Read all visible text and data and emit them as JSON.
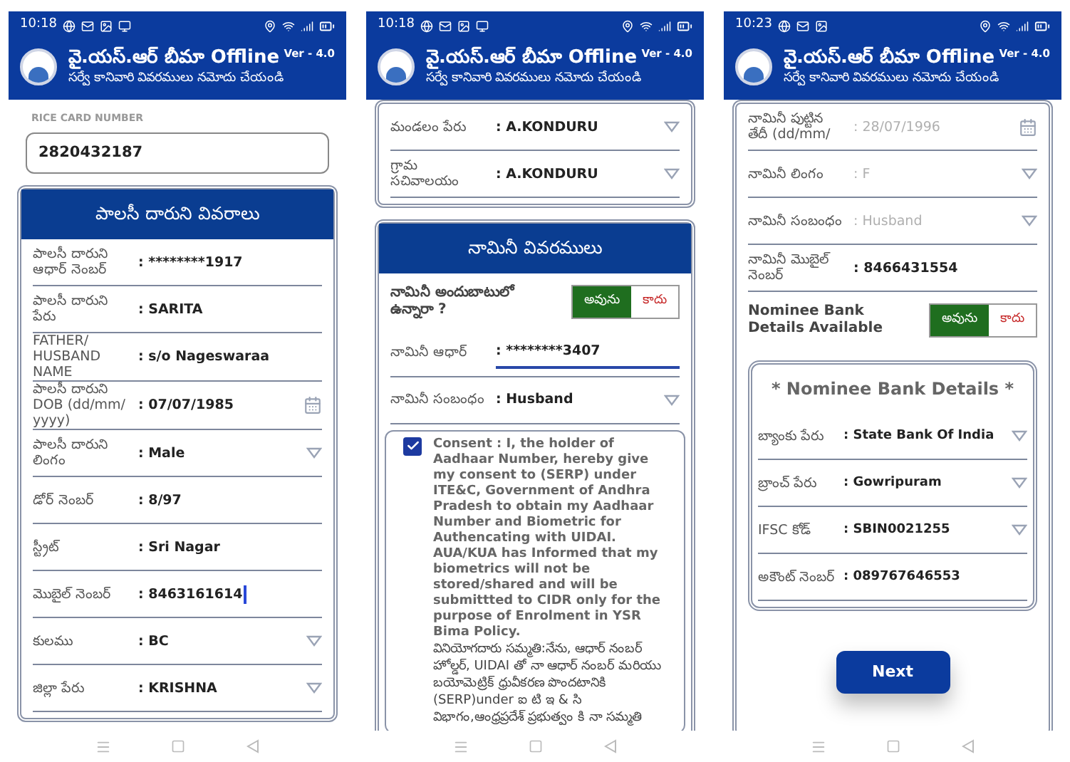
{
  "phones": [
    {
      "status_time": "10:18",
      "notification_icons": [
        {
          "kind": "globe"
        },
        {
          "kind": "mail"
        },
        {
          "kind": "image"
        },
        {
          "kind": "screen"
        }
      ],
      "header": {
        "title": "వై.యస్.ఆర్ బీమా Offline",
        "version": "Ver - 4.0",
        "subtitle": "సర్వే కానివారి వివరములు నమోదు చేయండి"
      },
      "sections": [
        {
          "kind": "rice_card",
          "label": "RICE CARD NUMBER",
          "value": "2820432187"
        },
        {
          "kind": "panel",
          "heading": "పాలసీ దారుని వివరాలు",
          "items": [
            {
              "kind": "text_row",
              "label": "పాలసీ దారుని ఆధార్ నెంబర్",
              "value": ": ********1917",
              "disabled": false,
              "focused": false
            },
            {
              "kind": "text_row",
              "label": "పాలసీ దారుని పేరు",
              "value": ": SARITA",
              "disabled": false,
              "focused": false
            },
            {
              "kind": "text_row",
              "label": "FATHER/ HUSBAND NAME",
              "value": ": s/o Nageswaraa",
              "disabled": false,
              "focused": false
            },
            {
              "kind": "date_row",
              "label": "పాలసీ దారుని DOB (dd/mm/ yyyy)",
              "value": ": 07/07/1985",
              "disabled": false,
              "focused": false
            },
            {
              "kind": "dropdown_row",
              "label": "పాలసీ దారుని లింగం",
              "value": ": Male",
              "disabled": false,
              "focused": false
            },
            {
              "kind": "text_row",
              "label": "డోర్ నెంబర్",
              "value": ": 8/97",
              "disabled": false,
              "focused": false
            },
            {
              "kind": "text_row",
              "label": "స్ట్రీట్",
              "value": ": Sri Nagar",
              "disabled": false,
              "focused": false
            },
            {
              "kind": "text_row",
              "label": "మొబైల్ నెంబర్",
              "value": ": 8463161614",
              "disabled": false,
              "focused": true
            },
            {
              "kind": "dropdown_row",
              "label": "కులము",
              "value": ": BC",
              "disabled": false,
              "focused": false
            },
            {
              "kind": "dropdown_row",
              "label": "జిల్లా పేరు",
              "value": ": KRISHNA",
              "disabled": false,
              "focused": false
            }
          ]
        }
      ]
    },
    {
      "status_time": "10:18",
      "notification_icons": [
        {
          "kind": "globe"
        },
        {
          "kind": "mail"
        },
        {
          "kind": "image"
        },
        {
          "kind": "screen"
        }
      ],
      "header": {
        "title": "వై.యస్.ఆర్ బీమా Offline",
        "version": "Ver - 4.0",
        "subtitle": "సర్వే కానివారి వివరములు నమోదు చేయండి"
      },
      "sections": [
        {
          "kind": "panel",
          "items": [
            {
              "kind": "dropdown_row",
              "label": "మండలం పేరు",
              "value": ": A.KONDURU",
              "disabled": false,
              "focused": false
            },
            {
              "kind": "dropdown_row",
              "label": "గ్రామ సచివాలయం",
              "value": ": A.KONDURU",
              "disabled": false,
              "focused": false
            }
          ]
        },
        {
          "kind": "panel",
          "heading": "నామినీ వివరములు",
          "items": [
            {
              "kind": "toggle",
              "label": "నామినీ అందుబాటులో ఉన్నారా ?",
              "options": [
                {
                  "label": "అవును",
                  "selected": true
                },
                {
                  "label": "కాదు",
                  "selected": false
                }
              ]
            },
            {
              "kind": "input_row",
              "label": "నామినీ ఆధార్",
              "value": ": ********3407",
              "disabled": false,
              "focused": false
            },
            {
              "kind": "dropdown_row",
              "label": "నామినీ సంబంధం",
              "value": ": Husband",
              "disabled": false,
              "focused": false
            },
            {
              "kind": "consent",
              "checked": true,
              "english": "Consent : I, the holder of Aadhaar Number, hereby give my consent to (SERP) under ITE&C, Government of Andhra Pradesh to obtain my Aadhaar Number and Biometric for Authencating with UIDAI. AUA/KUA has Informed that my biometrics will not be stored/shared and will be submittted to CIDR only for the purpose of Enrolment in YSR Bima Policy.",
              "telugu": "వినియోగదారు సమ్మతి:నేను, ఆధార్ నంబర్ హోల్డర్, UIDAI తో నా ఆధార్ నంబర్ మరియు బయోమెట్రిక్ ధ్రువీకరణ పొందటానికి (SERP)under ఐ టి ఇ & సి విభాగం,ఆంధ్రప్రదేశ్ ప్రభుత్వం కి నా సమ్మతి"
            }
          ]
        }
      ]
    },
    {
      "status_time": "10:23",
      "notification_icons": [
        {
          "kind": "globe"
        },
        {
          "kind": "mail"
        },
        {
          "kind": "image"
        }
      ],
      "header": {
        "title": "వై.యస్.ఆర్ బీమా Offline",
        "version": "Ver - 4.0",
        "subtitle": "సర్వే కానివారి వివరములు నమోదు చేయండి"
      },
      "sections": [
        {
          "kind": "panel",
          "items": [
            {
              "kind": "date_row",
              "label": "నామినీ పుట్టిన తేదీ (dd/mm/",
              "value": ": 28/07/1996",
              "disabled": true,
              "focused": false
            },
            {
              "kind": "dropdown_row",
              "label": "నామినీ లింగం",
              "value": ": F",
              "disabled": true,
              "focused": false
            },
            {
              "kind": "dropdown_row",
              "label": "నామినీ సంబంధం",
              "value": ": Husband",
              "disabled": true,
              "focused": false
            },
            {
              "kind": "text_row",
              "label": "నామినీ మొబైల్ నెంబర్",
              "value": ": 8466431554",
              "disabled": false,
              "focused": false
            },
            {
              "kind": "toggle",
              "label": "Nominee Bank Details Available",
              "options": [
                {
                  "label": "అవును",
                  "selected": true
                },
                {
                  "label": "కాదు",
                  "selected": false
                }
              ]
            },
            {
              "kind": "subpanel",
              "heading": "* Nominee Bank Details *",
              "items": [
                {
                  "kind": "dropdown_row",
                  "label": "బ్యాంకు పేరు",
                  "value": ": State Bank Of India",
                  "disabled": false,
                  "focused": false
                },
                {
                  "kind": "dropdown_row",
                  "label": "బ్రాంచ్ పేరు",
                  "value": ": Gowripuram",
                  "disabled": false,
                  "focused": false
                },
                {
                  "kind": "dropdown_row",
                  "label": "IFSC కోడ్",
                  "value": ": SBIN0021255",
                  "disabled": false,
                  "focused": false
                },
                {
                  "kind": "text_row",
                  "label": "అకౌంట్ నెంబర్",
                  "value": ": 089767646553",
                  "disabled": false,
                  "focused": false
                }
              ]
            },
            {
              "kind": "button",
              "label": "Next"
            }
          ]
        }
      ]
    }
  ]
}
